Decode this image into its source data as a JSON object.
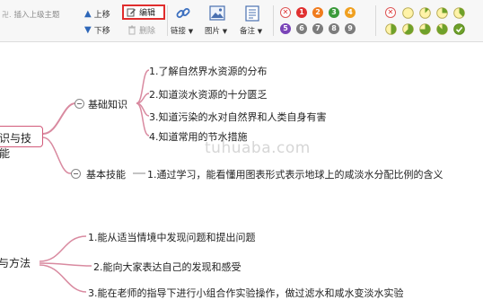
{
  "toolbar": {
    "insert_parent_label": "插入上级主题",
    "move_up_label": "上移",
    "move_down_label": "下移",
    "edit_label": "编辑",
    "delete_label": "删除",
    "link_label": "链接",
    "image_label": "图片",
    "note_label": "备注",
    "priority_badges": [
      {
        "label": "1",
        "color": "#e03030"
      },
      {
        "label": "2",
        "color": "#f07b1c"
      },
      {
        "label": "3",
        "color": "#3a9a3a"
      },
      {
        "label": "4",
        "color": "#f0a020"
      },
      {
        "label": "5",
        "color": "#7a44b8"
      },
      {
        "label": "6",
        "color": "#7c7c7c"
      },
      {
        "label": "7",
        "color": "#7c7c7c"
      },
      {
        "label": "8",
        "color": "#7c7c7c"
      },
      {
        "label": "9",
        "color": "#7c7c7c"
      }
    ],
    "progress_icons": [
      "none",
      "0",
      "1/8",
      "1/4",
      "3/8",
      "1/2",
      "5/8",
      "3/4",
      "7/8",
      "done"
    ]
  },
  "mindmap": {
    "topic_1": "识与技能",
    "branch_basic_knowledge": "基础知识",
    "basic_items": [
      "1.了解自然界水资源的分布",
      "2.知道淡水资源的十分匮乏",
      "3.知道污染的水对自然界和人类自身有害",
      "4.知道常用的节水措施"
    ],
    "branch_basic_skill": "基本技能",
    "skill_item": "1.通过学习，能看懂用图表形式表示地球上的咸淡水分配比例的含义",
    "topic_2": "与方法",
    "method_items": [
      "1.能从适当情境中发现问题和提出问题",
      "2.能向大家表达自己的发现和感受",
      "3.能在老师的指导下进行小组合作实验操作，做过滤水和咸水变淡水实验"
    ]
  },
  "watermark": "tuhuaba.com"
}
